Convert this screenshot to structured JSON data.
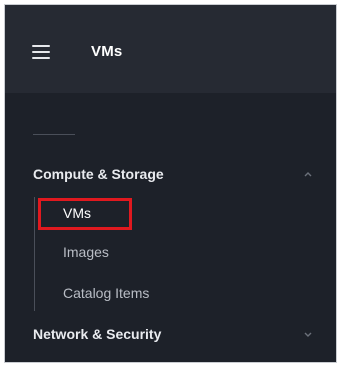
{
  "header": {
    "menu_icon": "hamburger-menu-icon",
    "title": "VMs"
  },
  "sidebar": {
    "sections": [
      {
        "label": "Compute & Storage",
        "expanded": true,
        "chevron_icon": "chevron-up-icon",
        "items": [
          {
            "label": "VMs",
            "active": true
          },
          {
            "label": "Images",
            "active": false
          },
          {
            "label": "Catalog Items",
            "active": false
          }
        ]
      },
      {
        "label": "Network & Security",
        "expanded": false,
        "chevron_icon": "chevron-down-icon"
      }
    ]
  },
  "colors": {
    "background": "#1d2129",
    "header_background": "#262a33",
    "text_primary": "#ffffff",
    "text_secondary": "#b9bdc5",
    "highlight": "#e0191f"
  }
}
